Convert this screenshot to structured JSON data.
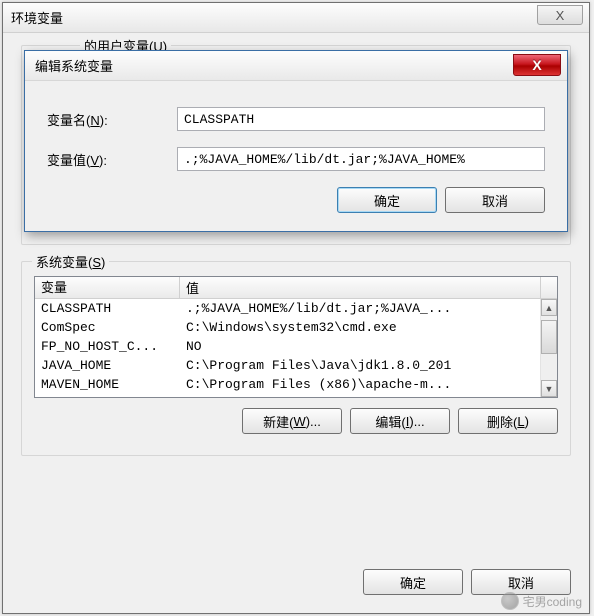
{
  "outerDialog": {
    "title": "环境变量",
    "close": "X",
    "userGroupPartial": "的用户变量(U)",
    "ok": "确定",
    "cancel": "取消"
  },
  "sysGroup": {
    "legend_pre": "系统变量(",
    "legend_key": "S",
    "legend_post": ")",
    "col_var": "变量",
    "col_val": "值",
    "rows": [
      {
        "name": "CLASSPATH",
        "value": ".;%JAVA_HOME%/lib/dt.jar;%JAVA_..."
      },
      {
        "name": "ComSpec",
        "value": "C:\\Windows\\system32\\cmd.exe"
      },
      {
        "name": "FP_NO_HOST_C...",
        "value": "NO"
      },
      {
        "name": "JAVA_HOME",
        "value": "C:\\Program Files\\Java\\jdk1.8.0_201"
      },
      {
        "name": "MAVEN_HOME",
        "value": "C:\\Program Files (x86)\\apache-m..."
      }
    ],
    "new_pre": "新建(",
    "new_key": "W",
    "new_post": ")...",
    "edit_pre": "编辑(",
    "edit_key": "I",
    "edit_post": ")...",
    "del_pre": "删除(",
    "del_key": "L",
    "del_post": ")"
  },
  "editDialog": {
    "title": "编辑系统变量",
    "close": "X",
    "name_pre": "变量名(",
    "name_key": "N",
    "name_post": "):",
    "value_pre": "变量值(",
    "value_key": "V",
    "value_post": "):",
    "nameField": "CLASSPATH",
    "valueField": ".;%JAVA_HOME%/lib/dt.jar;%JAVA_HOME%",
    "ok": "确定",
    "cancel": "取消"
  },
  "watermark": "宅男coding"
}
